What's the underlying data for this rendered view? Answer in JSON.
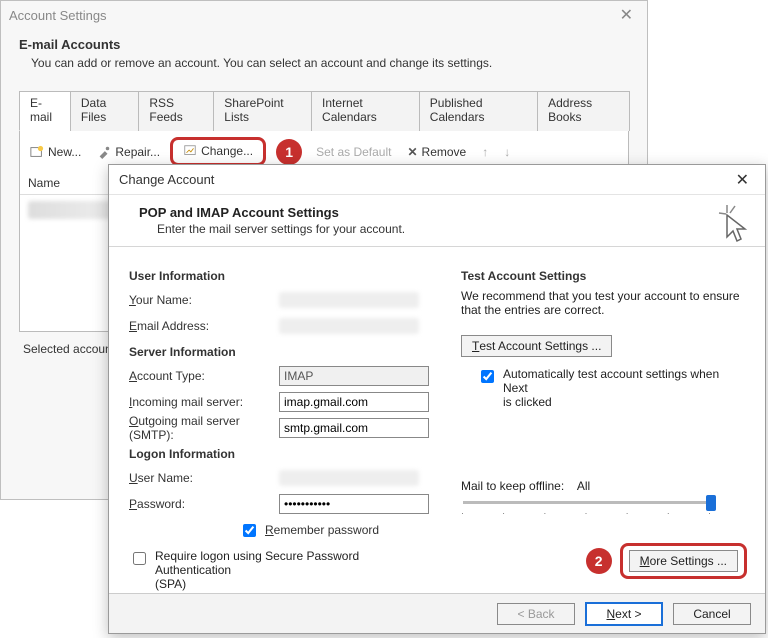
{
  "backWindow": {
    "title": "Account Settings",
    "heading": "E-mail Accounts",
    "subtext": "You can add or remove an account. You can select an account and change its settings.",
    "tabs": [
      "E-mail",
      "Data Files",
      "RSS Feeds",
      "SharePoint Lists",
      "Internet Calendars",
      "Published Calendars",
      "Address Books"
    ],
    "toolbar": {
      "new": "New...",
      "repair": "Repair...",
      "change": "Change...",
      "setDefault": "Set as Default",
      "remove": "Remove"
    },
    "listHeader": "Name",
    "selectedText": "Selected account de"
  },
  "annotations": {
    "badge1": "1",
    "badge2": "2"
  },
  "frontWindow": {
    "title": "Change Account",
    "headerTitle": "POP and IMAP Account Settings",
    "headerSub": "Enter the mail server settings for your account.",
    "sections": {
      "user": "User Information",
      "server": "Server Information",
      "logon": "Logon Information"
    },
    "labels": {
      "yourName": "Your Name:",
      "email": "Email Address:",
      "acctType": "Account Type:",
      "incoming": "Incoming mail server:",
      "outgoing": "Outgoing mail server (SMTP):",
      "username": "User Name:",
      "password": "Password:",
      "remember": "Remember password",
      "spa": "Require logon using Secure Password Authentication (SPA)"
    },
    "values": {
      "acctType": "IMAP",
      "incoming": "imap.gmail.com",
      "outgoing": "smtp.gmail.com",
      "password": "***********"
    },
    "right": {
      "testHeading": "Test Account Settings",
      "testText": "We recommend that you test your account to ensure that the entries are correct.",
      "testBtn": "Test Account Settings ...",
      "autoTest": "Automatically test account settings when Next is clicked",
      "mailKeepLabel": "Mail to keep offline:",
      "mailKeepValue": "All",
      "moreSettings": "More Settings ..."
    },
    "footer": {
      "back": "< Back",
      "next": "Next >",
      "cancel": "Cancel"
    }
  }
}
